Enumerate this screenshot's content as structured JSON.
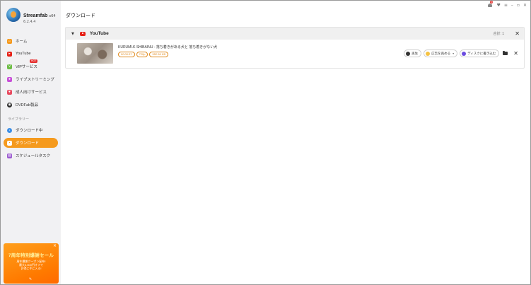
{
  "app": {
    "name": "Streamfab",
    "arch": "x64",
    "version": "6.2.4.4"
  },
  "sidebar": {
    "items": [
      {
        "label": "ホーム",
        "icon": "home-icon",
        "color": "#f59a1e"
      },
      {
        "label": "YouTube",
        "icon": "youtube-icon",
        "color": "#e62117"
      },
      {
        "label": "VIPサービス",
        "icon": "vip-icon",
        "color": "#6dbd45",
        "badge": "HOT"
      },
      {
        "label": "ライブストリーミング",
        "icon": "live-icon",
        "color": "#c84fd8"
      },
      {
        "label": "成人向けサービス",
        "icon": "adult-icon",
        "color": "#e84a5f"
      },
      {
        "label": "DVDFab製品",
        "icon": "dvdfab-icon",
        "color": "#2c2c2c"
      }
    ],
    "library_label": "ライブラリー",
    "library_items": [
      {
        "label": "ダウンロード中",
        "icon": "downloading-icon",
        "color": "#3a8ee6"
      },
      {
        "label": "ダウンロード",
        "icon": "downloaded-icon",
        "color": "#f59a1e",
        "active": true
      },
      {
        "label": "スケジュールタスク",
        "icon": "schedule-icon",
        "color": "#9b59d0"
      }
    ],
    "promo": {
      "title": "7周年特別爆謝セール",
      "line1": "周年爆謝クーポン配布!",
      "line2": "最大3,600円オフで",
      "line3": "お得に手に入る!",
      "close": "×"
    }
  },
  "header": {
    "title": "ダウンロード",
    "notification_count": "3"
  },
  "download_group": {
    "name": "YouTube",
    "total": "合計: 1",
    "items": [
      {
        "title": "KURUMI.K SHIBAINU - 落ち着きがある犬と 落ち着きがない犬",
        "duration": "00:00:37",
        "resolution": "720p",
        "size": "552.56 KB",
        "play_label": "再生",
        "ad_label": "広告を再める",
        "burn_label": "ディスクに書き込む"
      }
    ]
  },
  "colors": {
    "accent": "#f59a1e",
    "sidebar_bg": "#f1f1f3",
    "youtube_red": "#e62117"
  }
}
